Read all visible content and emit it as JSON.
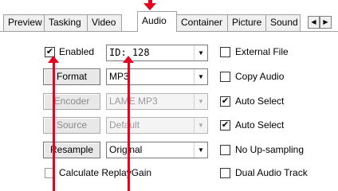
{
  "tabs": [
    {
      "label": "Preview"
    },
    {
      "label": "Tasking"
    },
    {
      "label": "Video"
    },
    {
      "label": "Audio",
      "active": true
    },
    {
      "label": "Container"
    },
    {
      "label": "Picture"
    },
    {
      "label": "Sound"
    }
  ],
  "tab_scroll": {
    "left": "◀",
    "right": "▶"
  },
  "track": {
    "enabled_label": "Enabled",
    "enabled_checked": "✔",
    "track_id": "ID: 128"
  },
  "rows": {
    "format": {
      "button": "Format",
      "value": "MP3"
    },
    "encoder": {
      "button": "Encoder",
      "value": "LAME MP3"
    },
    "source": {
      "button": "Source",
      "value": "Default"
    },
    "resample": {
      "button": "Resample",
      "value": "Original"
    }
  },
  "options": {
    "external_file": "External File",
    "copy_audio": "Copy Audio",
    "auto_select_1": "Auto Select",
    "auto_select_2": "Auto Select",
    "no_upsampling": "No Up-sampling",
    "dual_audio_track": "Dual Audio Track",
    "calculate_replaygain": "Calculate ReplayGain"
  },
  "checks": {
    "mark": "✔"
  },
  "combo_arrow": "▼",
  "colors": {
    "annotation_red": "#e8001c",
    "tab_border": "#a0a0a0"
  }
}
